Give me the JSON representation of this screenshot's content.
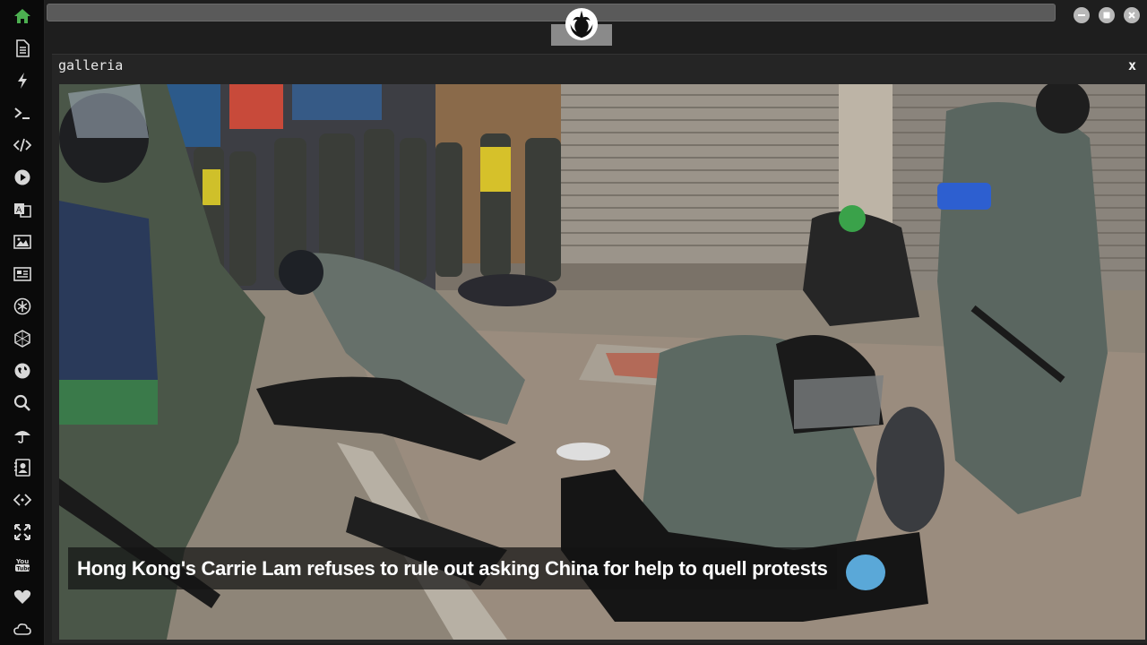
{
  "sidebar": {
    "items": [
      {
        "icon": "home-icon",
        "color": "#4caf50"
      },
      {
        "icon": "document-icon"
      },
      {
        "icon": "lightning-icon"
      },
      {
        "icon": "terminal-icon"
      },
      {
        "icon": "code-icon"
      },
      {
        "icon": "play-icon"
      },
      {
        "icon": "translate-icon"
      },
      {
        "icon": "image-icon"
      },
      {
        "icon": "newspaper-icon"
      },
      {
        "icon": "snowflake-icon"
      },
      {
        "icon": "hexagon-icon"
      },
      {
        "icon": "globe-icon"
      },
      {
        "icon": "search-icon"
      },
      {
        "icon": "umbrella-icon"
      },
      {
        "icon": "contact-icon"
      },
      {
        "icon": "embed-icon"
      },
      {
        "icon": "expand-icon"
      },
      {
        "icon": "youtube-icon"
      },
      {
        "icon": "heart-icon"
      },
      {
        "icon": "cloud-icon"
      }
    ]
  },
  "window": {
    "title": "galleria",
    "close_label": "x"
  },
  "gallery": {
    "caption": "Hong Kong's Carrie Lam refuses to rule out asking China for help to quell protests"
  },
  "colors": {
    "accent": "#4caf50",
    "icon": "#d8d8d8",
    "window_bg": "#252525"
  }
}
